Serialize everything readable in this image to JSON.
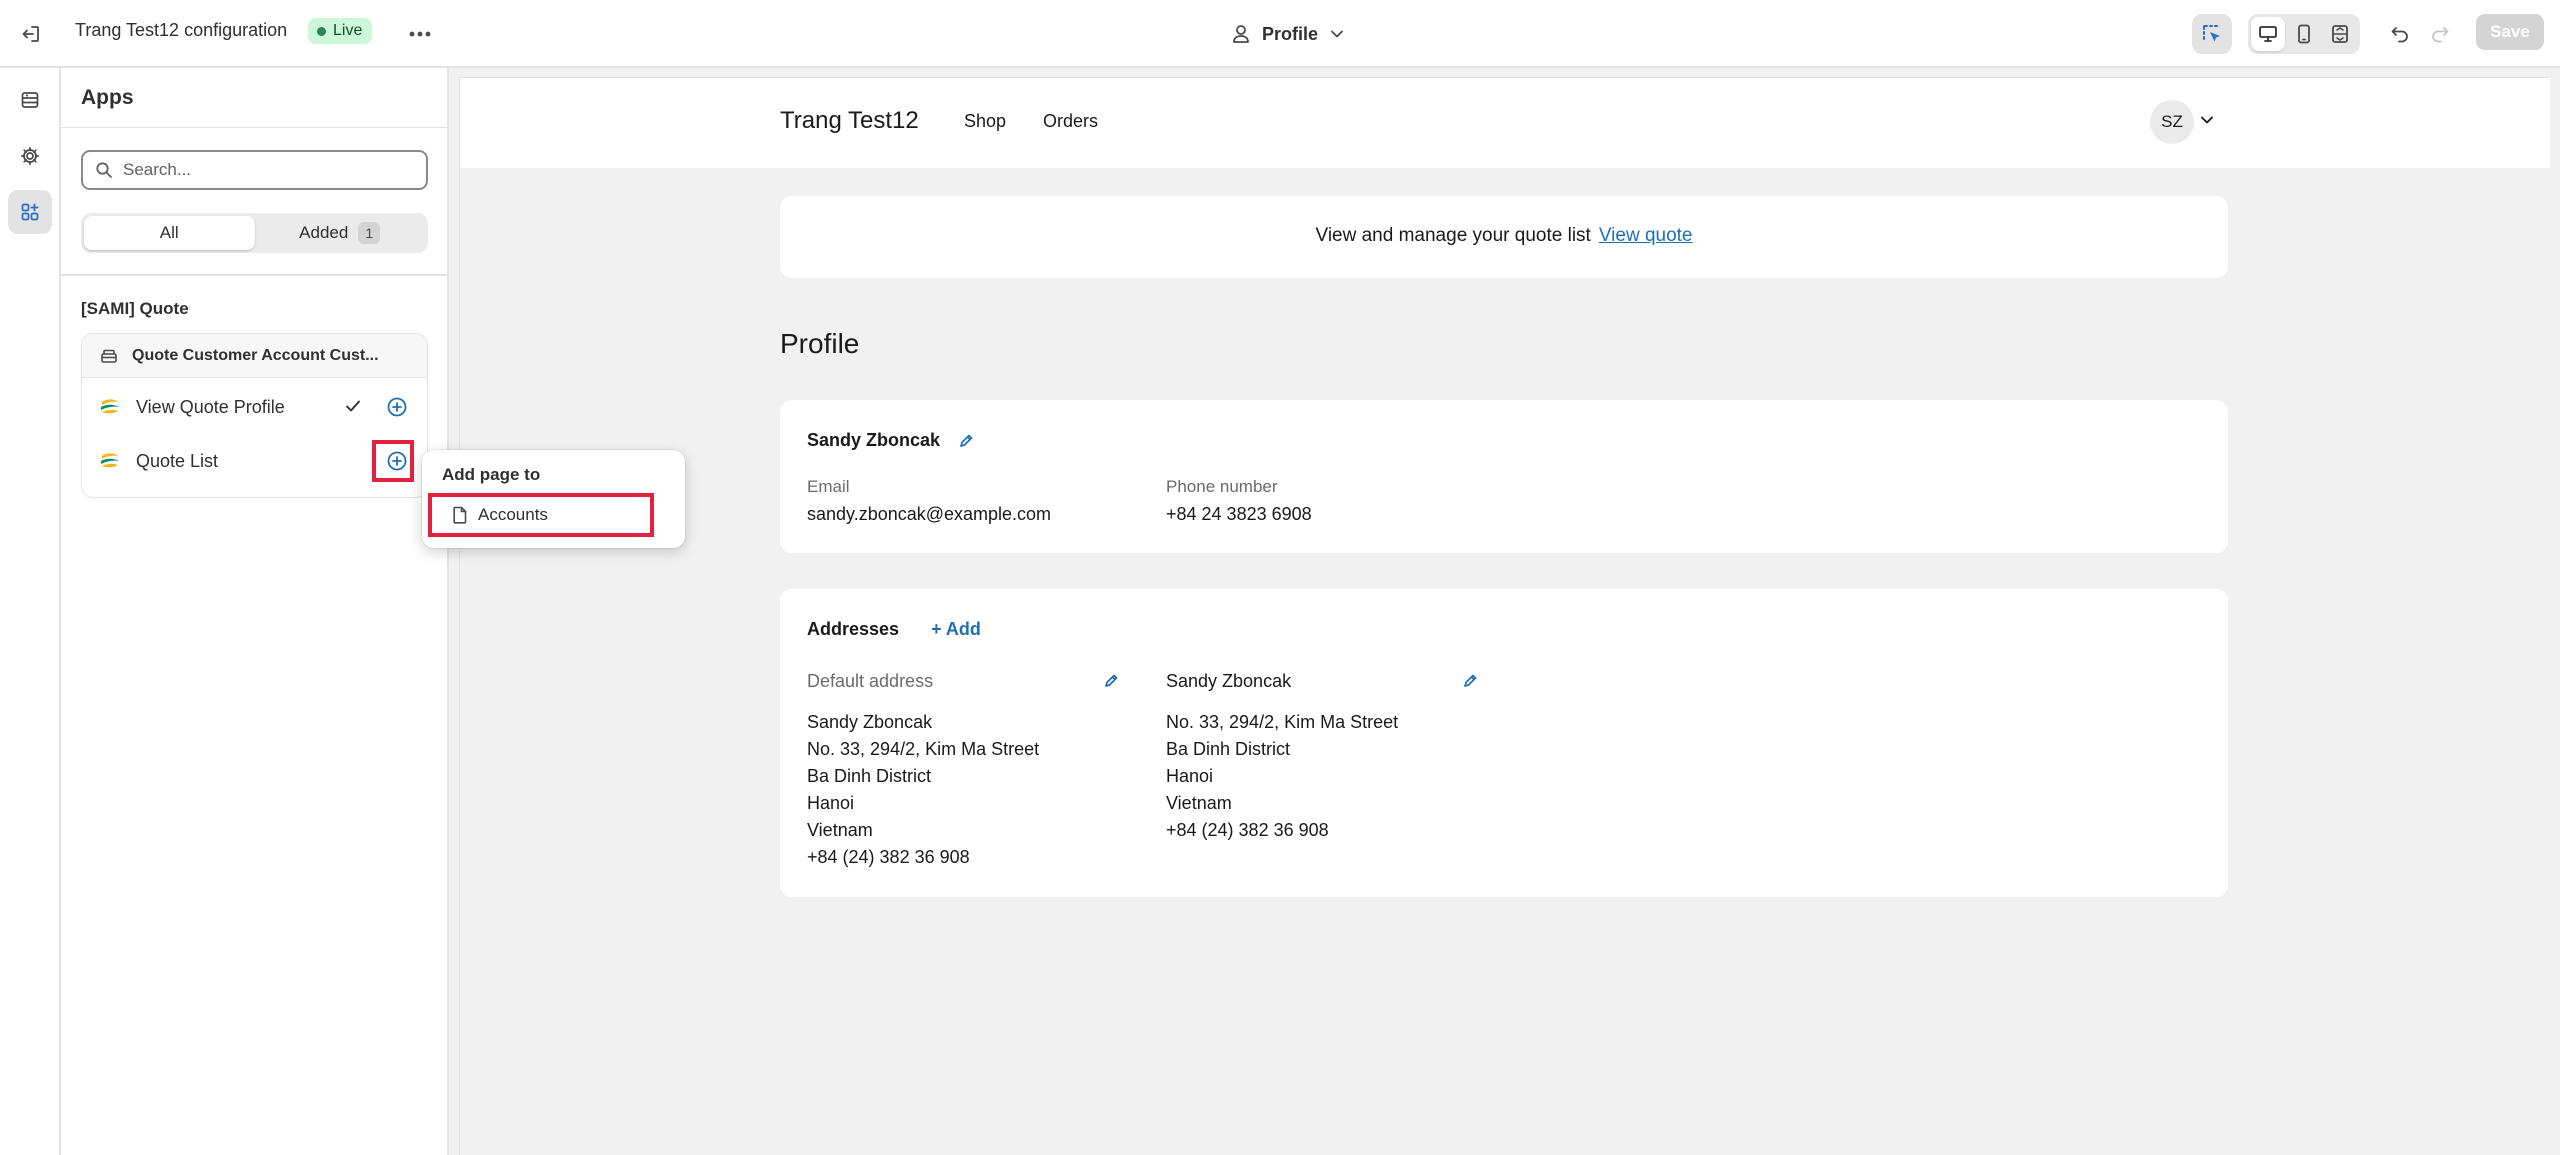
{
  "topbar": {
    "title": "Trang Test12 configuration",
    "live_label": "Live",
    "page_selector": "Profile",
    "save_label": "Save"
  },
  "panel": {
    "title": "Apps",
    "search_placeholder": "Search...",
    "tabs": [
      {
        "label": "All",
        "active": true
      },
      {
        "label": "Added",
        "count": "1",
        "active": false
      }
    ],
    "group_title": "[SAMI] Quote",
    "card_header": "Quote Customer Account Cust...",
    "items": [
      {
        "label": "View Quote Profile",
        "added": true
      },
      {
        "label": "Quote List",
        "added": false
      }
    ]
  },
  "popover": {
    "title": "Add page to",
    "item": "Accounts"
  },
  "preview": {
    "store_name": "Trang Test12",
    "nav": [
      "Shop",
      "Orders"
    ],
    "avatar": "SZ",
    "banner_text": "View and manage your quote list",
    "banner_link": "View quote",
    "heading": "Profile",
    "customer": {
      "name": "Sandy Zboncak",
      "email_label": "Email",
      "email": "sandy.zboncak@example.com",
      "phone_label": "Phone number",
      "phone": "+84 24 3823 6908"
    },
    "addresses": {
      "title": "Addresses",
      "add_label": "+ Add",
      "default_title": "Default address",
      "default_lines": [
        "Sandy Zboncak",
        "No. 33, 294/2, Kim Ma Street",
        "Ba Dinh District",
        "Hanoi",
        "Vietnam",
        "+84 (24) 382 36 908"
      ],
      "second_title": "Sandy Zboncak",
      "second_lines": [
        "No. 33, 294/2, Kim Ma Street",
        "Ba Dinh District",
        "Hanoi",
        "Vietnam",
        "+84 (24) 382 36 908"
      ]
    }
  },
  "colors": {
    "accent_blue": "#1f6fb4",
    "highlight_red": "#e3223f",
    "live_green_bg": "#cdf7d8"
  }
}
